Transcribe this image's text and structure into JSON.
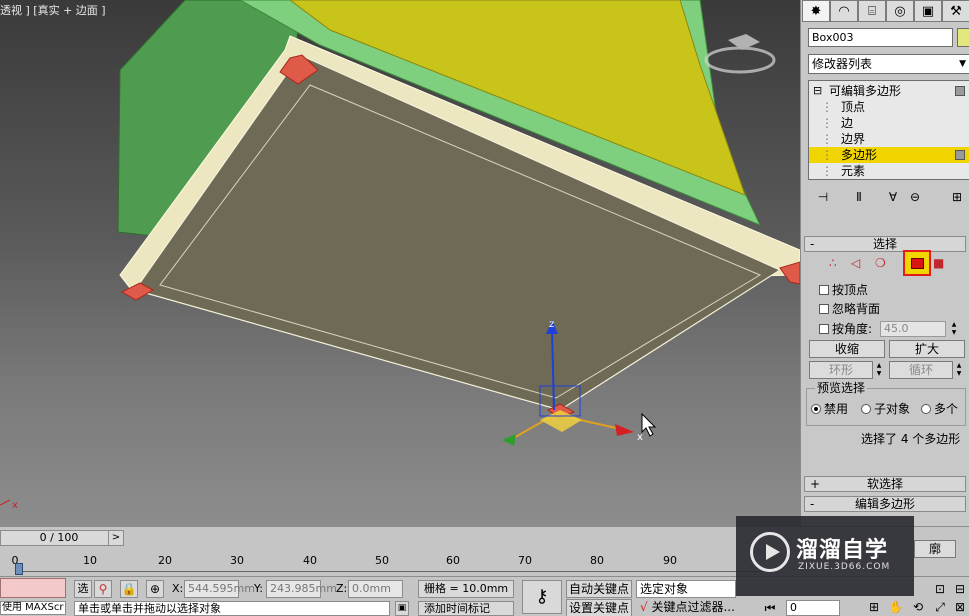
{
  "viewport": {
    "label": "透视 ] [真实 + 边面 ]",
    "axis_z": "z",
    "axis_x": "x",
    "stray_x": "x"
  },
  "command_panel": {
    "tabs": [
      {
        "icon": "create-icon",
        "glyph": "✸"
      },
      {
        "icon": "modify-icon",
        "glyph": "◠"
      },
      {
        "icon": "hierarchy-icon",
        "glyph": "⌸"
      },
      {
        "icon": "motion-icon",
        "glyph": "◎"
      },
      {
        "icon": "display-icon",
        "glyph": "▣"
      },
      {
        "icon": "utilities-icon",
        "glyph": "⚒"
      }
    ],
    "object_name": "Box003",
    "object_color": "#e3e87e",
    "modifier_list": "修改器列表",
    "stack": {
      "root": "可编辑多边形",
      "items": [
        "顶点",
        "边",
        "边界",
        "多边形",
        "元素"
      ],
      "selected": "多边形"
    },
    "selection": {
      "title": "选择",
      "by_vertex": "按顶点",
      "ignore_backfacing": "忽略背面",
      "by_angle": "按角度:",
      "angle_value": "45.0",
      "shrink": "收缩",
      "grow": "扩大",
      "ring": "环形",
      "loop": "循环",
      "preview_title": "预览选择",
      "preview_options": [
        "禁用",
        "子对象",
        "多个"
      ],
      "preview_selected": "禁用",
      "status": "选择了 4 个多边形"
    },
    "soft_selection": {
      "title": "软选择",
      "sign": "+"
    },
    "edit_polygon": {
      "title": "编辑多边形",
      "sign": "-"
    }
  },
  "timeline": {
    "frame_counter": "0 / 100",
    "next": ">",
    "ticks": [
      "0",
      "10",
      "20",
      "30",
      "40",
      "50",
      "60",
      "70",
      "80",
      "90"
    ],
    "current_frame": 0
  },
  "status_bar": {
    "maxscript": "使用 MAXScr",
    "lock_label": "选",
    "x_label": "X:",
    "x_value": "544.595mm",
    "y_label": "Y:",
    "y_value": "243.985mm",
    "z_label": "Z:",
    "z_value": "0.0mm",
    "grid": "栅格 = 10.0mm",
    "prompt": "单击或单击并拖动以选择对象",
    "add_time_tag": "添加时间标记",
    "auto_key": "自动关键点",
    "set_key": "设置关键点",
    "selection_set": "选定对象",
    "key_filters": "关键点过滤器...",
    "frame_value": "0"
  },
  "right_partial": {
    "outline_label": "廓"
  },
  "watermark": {
    "title": "溜溜自学",
    "url": "ZIXUE.3D66.COM"
  }
}
